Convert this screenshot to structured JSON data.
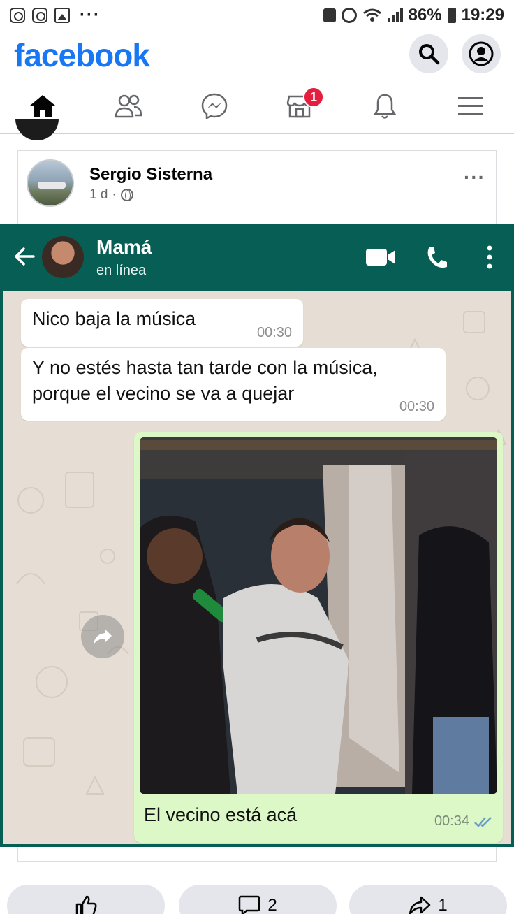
{
  "status_bar": {
    "battery": "86%",
    "time": "19:29",
    "overflow": "···"
  },
  "facebook": {
    "logo": "facebook",
    "nav": {
      "notifications_badge": "1"
    }
  },
  "post": {
    "author": "Sergio Sisterna",
    "age": "1 d",
    "separator": "·",
    "more": "···",
    "whatsapp": {
      "contact_name": "Mamá",
      "contact_status": "en línea",
      "messages": [
        {
          "text": "Nico baja la música",
          "time": "00:30",
          "direction": "incoming"
        },
        {
          "text": "Y no estés hasta tan tarde con la música, porque el vecino se va a quejar",
          "time": "00:30",
          "direction": "incoming"
        },
        {
          "text": "El vecino está acá",
          "time": "00:34",
          "direction": "outgoing"
        }
      ]
    },
    "reactions": {
      "comments_count": "2",
      "shares_count": "1"
    }
  },
  "colors": {
    "facebook_blue": "#1877f2",
    "whatsapp_header": "#075e54",
    "whatsapp_chat_bg": "#e6ddd4",
    "outgoing_bubble": "#dcf8c6",
    "badge_red": "#e41e3f"
  }
}
